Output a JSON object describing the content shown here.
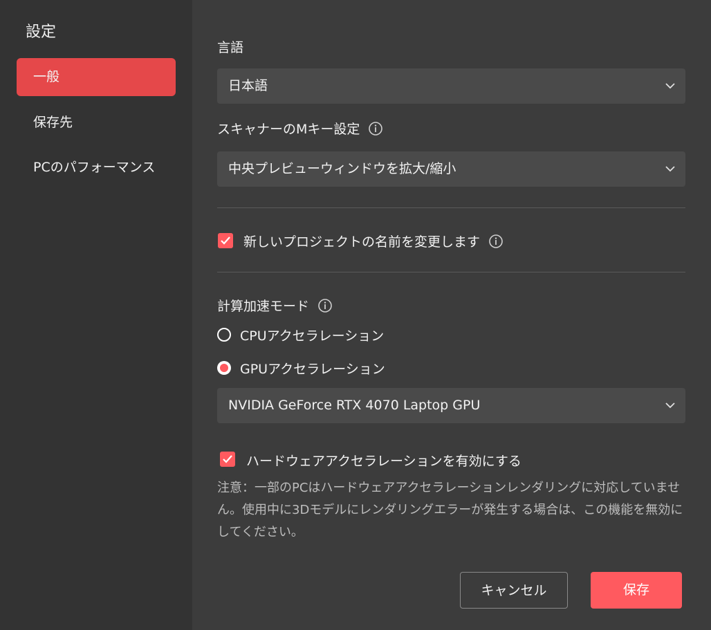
{
  "sidebar": {
    "title": "設定",
    "items": [
      {
        "label": "一般",
        "active": true
      },
      {
        "label": "保存先",
        "active": false
      },
      {
        "label": "PCのパフォーマンス",
        "active": false
      }
    ]
  },
  "language": {
    "label": "言語",
    "value": "日本語"
  },
  "scanner": {
    "label": "スキャナーのMキー設定",
    "value": "中央プレビューウィンドウを拡大/縮小"
  },
  "rename_project": {
    "label": "新しいプロジェクトの名前を変更します",
    "checked": true
  },
  "acceleration": {
    "label": "計算加速モード",
    "options": [
      {
        "label": "CPUアクセラレーション",
        "selected": false
      },
      {
        "label": "GPUアクセラレーション",
        "selected": true
      }
    ],
    "gpu_value": "NVIDIA GeForce RTX 4070 Laptop GPU"
  },
  "hardware_accel": {
    "label": "ハードウェアアクセラレーションを有効にする",
    "checked": true,
    "note": "注意：一部のPCはハードウェアアクセラレーションレンダリングに対応していません。使用中に3Dモデルにレンダリングエラーが発生する場合は、この機能を無効にしてください。"
  },
  "buttons": {
    "cancel": "キャンセル",
    "save": "保存"
  },
  "colors": {
    "accent": "#ff5a5f",
    "sidebar_active": "#e5484a",
    "sidebar_bg": "#333333",
    "main_bg": "#3c3c3c"
  }
}
